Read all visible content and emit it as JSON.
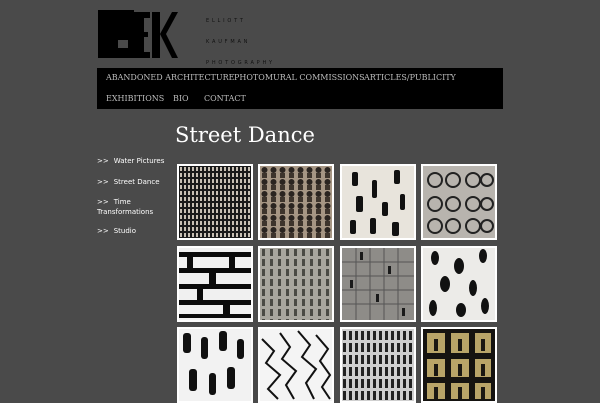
{
  "header": {
    "logo_text_lines": [
      "ELLIOTT",
      "KAUFMAN",
      "PHOTOGRAPHY"
    ]
  },
  "nav": {
    "items": [
      {
        "label": "ABANDONED ARCHITECTURE"
      },
      {
        "label": "PHOTOMURAL COMMISSIONS"
      },
      {
        "label": "ARTICLES/PUBLICITY"
      },
      {
        "label": "EXHIBITIONS"
      },
      {
        "label": "BIO"
      },
      {
        "label": "CONTACT"
      }
    ]
  },
  "sidebar": {
    "arrow": ">>",
    "items": [
      {
        "label": "Water Pictures"
      },
      {
        "label": "Street Dance"
      },
      {
        "label": "Time Transformations"
      },
      {
        "label": "Studio"
      }
    ]
  },
  "main": {
    "title": "Street Dance",
    "gallery": [
      {
        "name": "thumb-1"
      },
      {
        "name": "thumb-2"
      },
      {
        "name": "thumb-3"
      },
      {
        "name": "thumb-4"
      },
      {
        "name": "thumb-5"
      },
      {
        "name": "thumb-6"
      },
      {
        "name": "thumb-7"
      },
      {
        "name": "thumb-8"
      },
      {
        "name": "thumb-9"
      },
      {
        "name": "thumb-10"
      },
      {
        "name": "thumb-11"
      },
      {
        "name": "thumb-12"
      }
    ]
  },
  "colors": {
    "background": "#4a4a4a",
    "nav_background": "#000000",
    "nav_text": "#bdbdbd",
    "thumb_border": "#ffffff"
  }
}
